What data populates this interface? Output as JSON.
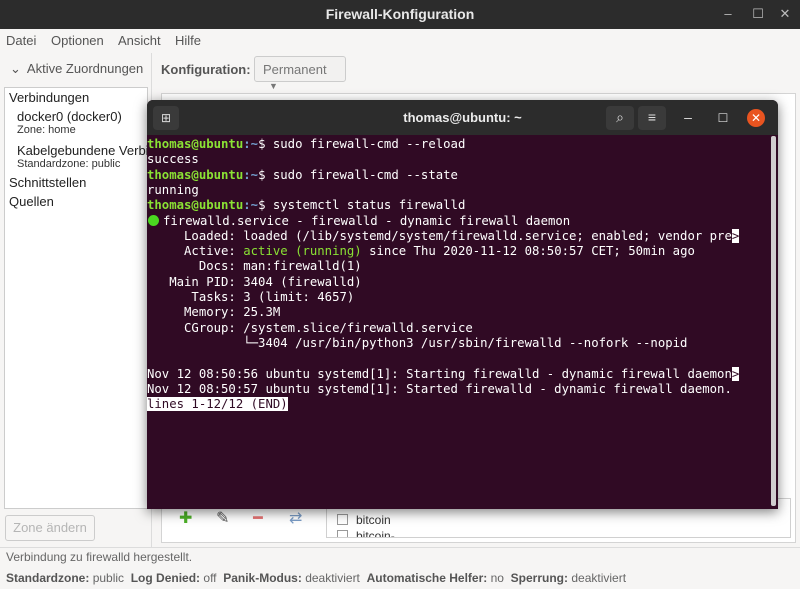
{
  "window": {
    "title": "Firewall-Konfiguration",
    "minimize": "–",
    "maximize": "☐",
    "close": "✕"
  },
  "menu": [
    "Datei",
    "Optionen",
    "Ansicht",
    "Hilfe"
  ],
  "left_pane": {
    "header": "Aktive Zuordnungen",
    "section_connections": "Verbindungen",
    "connections": [
      {
        "name": "docker0 (docker0)",
        "zone": "Zone: home"
      },
      {
        "name": "Kabelgebundene Verbi",
        "zone": "Standardzone: public"
      }
    ],
    "section_interfaces": "Schnittstellen",
    "section_sources": "Quellen",
    "change_zone_button": "Zone ändern"
  },
  "right_pane": {
    "config_label": "Konfiguration:",
    "config_value": "Permanent",
    "services_visible": [
      "bitcoin",
      "bitcoin-"
    ]
  },
  "status": {
    "message": "Verbindung zu firewalld hergestellt.",
    "items": [
      {
        "label": "Standardzone:",
        "value": "public"
      },
      {
        "label": "Log Denied:",
        "value": "off"
      },
      {
        "label": "Panik-Modus:",
        "value": "deaktiviert"
      },
      {
        "label": "Automatische Helfer:",
        "value": "no"
      },
      {
        "label": "Sperrung:",
        "value": "deaktiviert"
      }
    ]
  },
  "terminal": {
    "title": "thomas@ubuntu: ~",
    "prompt_user": "thomas@ubuntu",
    "prompt_path": ":~",
    "prompt_sign": "$ ",
    "lines": [
      {
        "type": "cmd",
        "text": "sudo firewall-cmd --reload"
      },
      {
        "type": "out",
        "text": "success"
      },
      {
        "type": "cmd",
        "text": "sudo firewall-cmd --state"
      },
      {
        "type": "out",
        "text": "running"
      },
      {
        "type": "cmd",
        "text": "systemctl status firewalld"
      },
      {
        "type": "status_head",
        "text": "firewalld.service - firewalld - dynamic firewall daemon"
      },
      {
        "type": "out",
        "text": "     Loaded: loaded (/lib/systemd/system/firewalld.service; enabled; vendor pre",
        "overflow": ">"
      },
      {
        "type": "active",
        "pre": "     Active: ",
        "status": "active (running)",
        "post": " since Thu 2020-11-12 08:50:57 CET; 50min ago"
      },
      {
        "type": "out",
        "text": "       Docs: man:firewalld(1)"
      },
      {
        "type": "out",
        "text": "   Main PID: 3404 (firewalld)"
      },
      {
        "type": "out",
        "text": "      Tasks: 3 (limit: 4657)"
      },
      {
        "type": "out",
        "text": "     Memory: 25.3M"
      },
      {
        "type": "out",
        "text": "     CGroup: /system.slice/firewalld.service"
      },
      {
        "type": "out",
        "text": "             └─3404 /usr/bin/python3 /usr/sbin/firewalld --nofork --nopid"
      },
      {
        "type": "out",
        "text": ""
      },
      {
        "type": "out",
        "text": "Nov 12 08:50:56 ubuntu systemd[1]: Starting firewalld - dynamic firewall daemon",
        "overflow": ">"
      },
      {
        "type": "out",
        "text": "Nov 12 08:50:57 ubuntu systemd[1]: Started firewalld - dynamic firewall daemon."
      },
      {
        "type": "pager",
        "text": "lines 1-12/12 (END)"
      }
    ],
    "colors": {
      "background": "#300a24",
      "prompt_user": "#8ae234",
      "prompt_path": "#729fcf",
      "active": "#8ae234",
      "dot": "#4ad820",
      "close_button": "#e95420"
    }
  }
}
